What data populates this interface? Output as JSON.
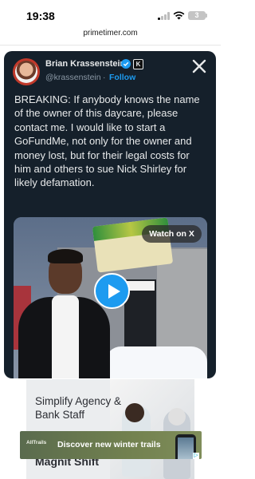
{
  "status": {
    "time": "19:38",
    "battery": "3"
  },
  "browser": {
    "url": "primetimer.com"
  },
  "tweet": {
    "author_name": "Brian Krassenstein",
    "handle": "@krassenstein",
    "separator": "·",
    "follow_label": "Follow",
    "affiliate_glyph": "K",
    "x_logo": "x-logo-icon",
    "text": "BREAKING:  If anybody knows the name of the owner of this daycare, please contact me. I would like to start a GoFundMe, not only for the owner and money lost, but for their legal costs for him and others to sue Nick Shirley for likely defamation.",
    "video": {
      "watch_label": "Watch on X",
      "play_icon": "play-icon"
    }
  },
  "ad": {
    "headline": "Simplify Agency & Bank Staff",
    "bottom_text": "Magnit Shift",
    "banner": {
      "brand": "AllTrails",
      "text": "Discover new winter trails"
    }
  },
  "colors": {
    "accent": "#1d9bf0",
    "tweet_bg": "#15202b",
    "verified": "#1d9bf0"
  }
}
